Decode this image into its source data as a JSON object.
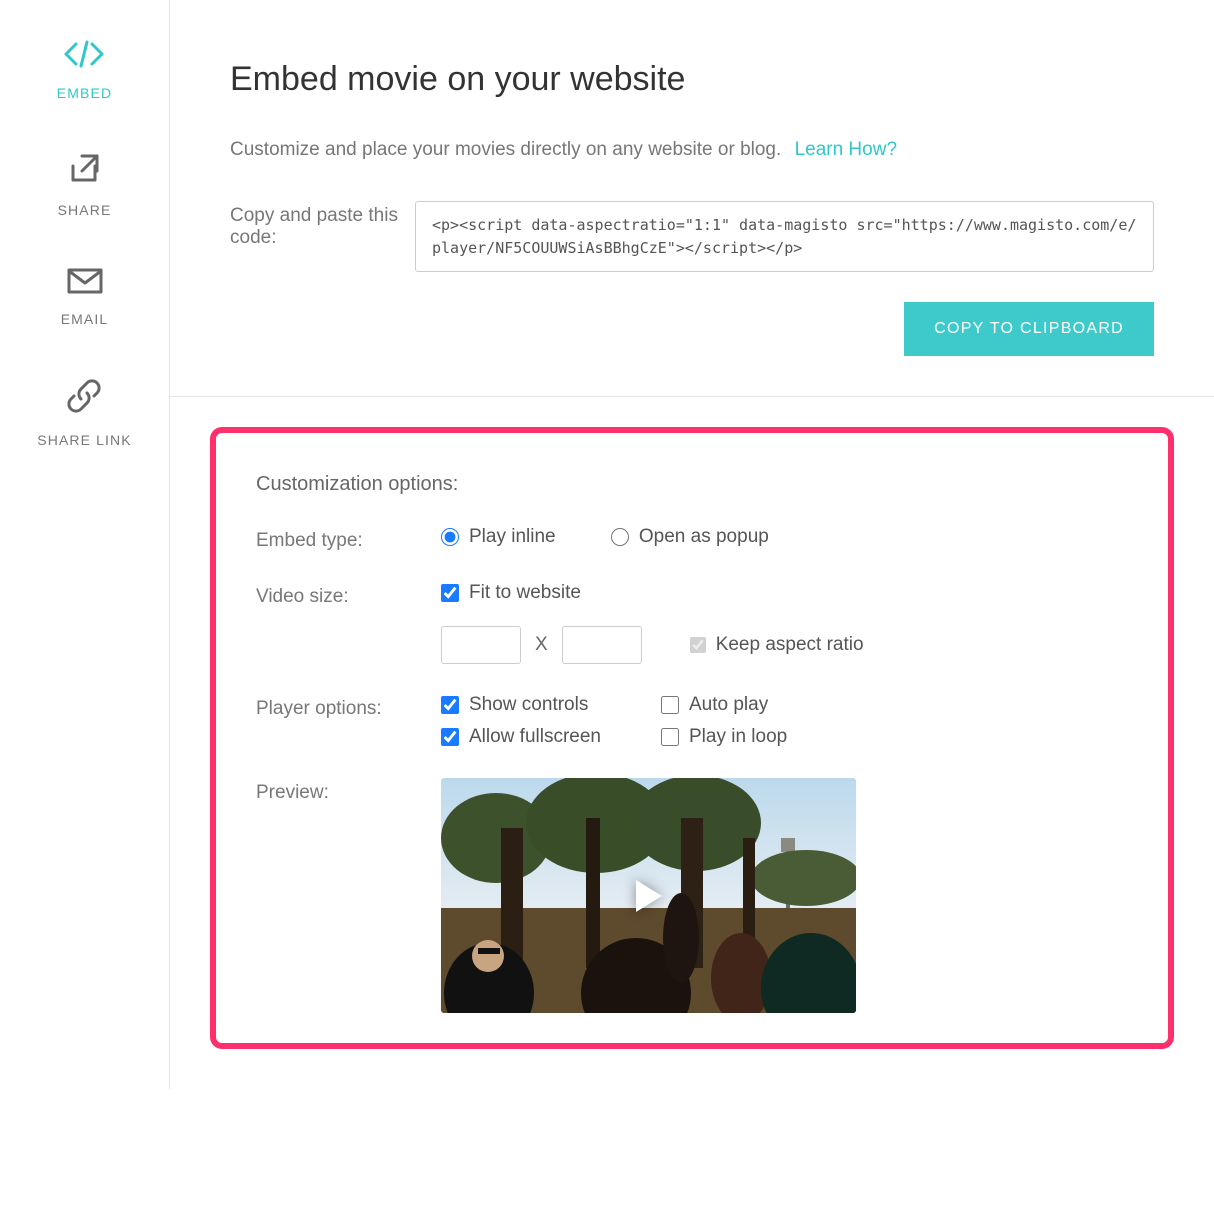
{
  "sidebar": {
    "items": [
      {
        "label": "EMBED"
      },
      {
        "label": "SHARE"
      },
      {
        "label": "EMAIL"
      },
      {
        "label": "SHARE LINK"
      }
    ]
  },
  "header": {
    "title": "Embed movie on your website",
    "subtitle": "Customize and place your movies directly on any website or blog.",
    "learn_link": "Learn How?"
  },
  "embed": {
    "copy_label": "Copy and paste this code:",
    "code": "<p><script data-aspectratio=\"1:1\" data-magisto src=\"https://www.magisto.com/e/player/NF5COUUWSiAsBBhgCzE\"></script></p>",
    "copy_btn": "COPY TO CLIPBOARD"
  },
  "options": {
    "title": "Customization options:",
    "embed_type": {
      "label": "Embed type:",
      "play_inline": "Play inline",
      "open_popup": "Open as popup"
    },
    "video_size": {
      "label": "Video size:",
      "fit": "Fit to website",
      "x": "X",
      "keep_ratio": "Keep aspect ratio",
      "width": "",
      "height": ""
    },
    "player": {
      "label": "Player options:",
      "show_controls": "Show controls",
      "auto_play": "Auto play",
      "allow_fullscreen": "Allow fullscreen",
      "play_loop": "Play in loop"
    },
    "preview": {
      "label": "Preview:"
    }
  }
}
